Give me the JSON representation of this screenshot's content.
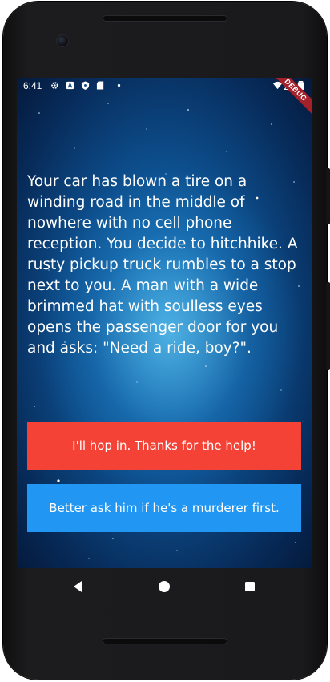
{
  "status_bar": {
    "time": "6:41",
    "icons": [
      "gear-icon",
      "a-box-icon",
      "shield-icon",
      "sd-card-icon",
      "dot-icon",
      "wifi-icon",
      "signal-icon",
      "battery-icon"
    ]
  },
  "debug_banner": "DEBUG",
  "story": {
    "text": "Your car has blown a tire on a winding road in the middle of nowhere with no cell phone reception. You decide to hitchhike. A rusty pickup truck rumbles to a stop next to you. A man with a wide brimmed hat with soulless eyes opens the passenger door for you and asks: \"Need a ride, boy?\"."
  },
  "choices": [
    {
      "label": "I'll hop in. Thanks for the help!",
      "color": "#f44336"
    },
    {
      "label": "Better ask him if he's a murderer first.",
      "color": "#2196f3"
    }
  ],
  "nav": {
    "icons": [
      "back-icon",
      "home-icon",
      "recents-icon"
    ]
  },
  "colors": {
    "background_gradient": [
      "#1a7ec4",
      "#041a3c"
    ]
  }
}
